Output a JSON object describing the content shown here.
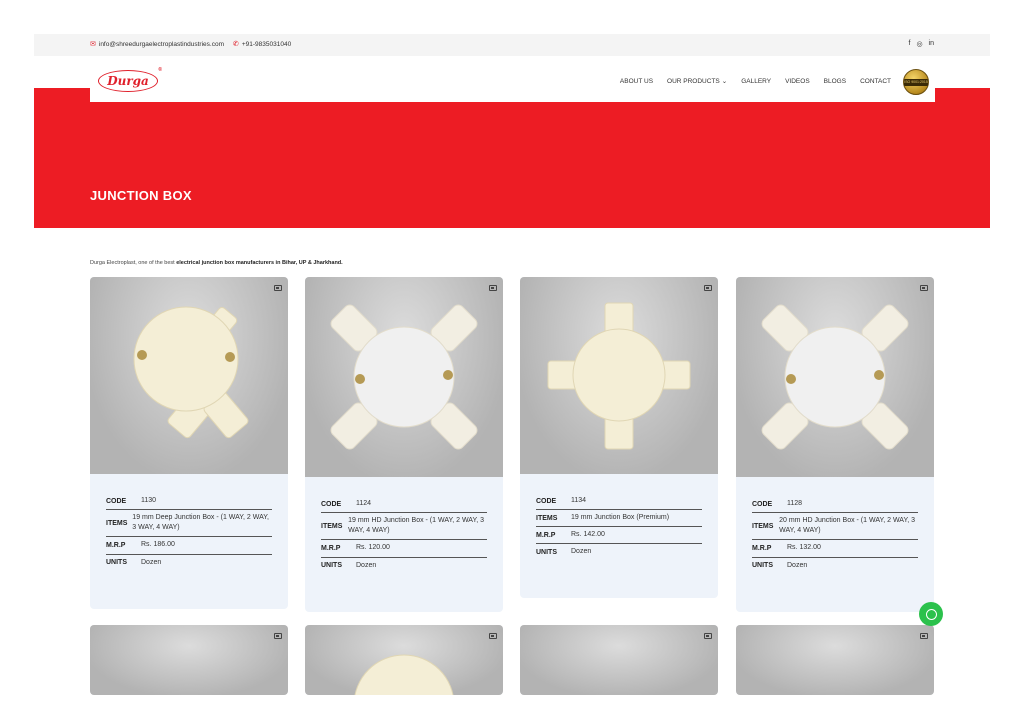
{
  "topbar": {
    "email": "info@shreedurgaelectroplastindustries.com",
    "phone": "+91-9835031040",
    "social": [
      "f",
      "◎",
      "in"
    ]
  },
  "brand": {
    "logo_text": "Durga",
    "reg_mark": "®",
    "badge_text": "ISO 9001:2015"
  },
  "nav": {
    "items": [
      "ABOUT US",
      "OUR PRODUCTS",
      "GALLERY",
      "VIDEOS",
      "BLOGS",
      "CONTACT"
    ],
    "dropdown_caret": "⌄"
  },
  "hero": {
    "title": "JUNCTION BOX"
  },
  "intro": {
    "prefix": "Durga Electroplast, one of the best ",
    "bold": "electrical junction box manufacturers in Bihar, UP & Jharkhand."
  },
  "labels": {
    "code": "CODE",
    "items": "ITEMS",
    "mrp": "M.R.P",
    "units": "UNITS"
  },
  "products": [
    {
      "code": "1130",
      "items": "19 mm Deep Junction Box - (1 WAY, 2 WAY, 3 WAY, 4 WAY)",
      "mrp": "Rs. 186.00",
      "units": "Dozen"
    },
    {
      "code": "1124",
      "items": "19 mm HD Junction Box - (1 WAY, 2 WAY, 3 WAY, 4 WAY)",
      "mrp": "Rs. 120.00",
      "units": "Dozen"
    },
    {
      "code": "1134",
      "items": "19 mm Junction Box (Premium)",
      "mrp": "Rs. 142.00",
      "units": "Dozen"
    },
    {
      "code": "1128",
      "items": "20 mm HD Junction Box - (1 WAY, 2 WAY, 3 WAY, 4 WAY)",
      "mrp": "Rs. 132.00",
      "units": "Dozen"
    }
  ],
  "colors": {
    "brand_red": "#ed1c24",
    "card_bg": "#eef3fa",
    "whatsapp": "#2bc14c"
  }
}
